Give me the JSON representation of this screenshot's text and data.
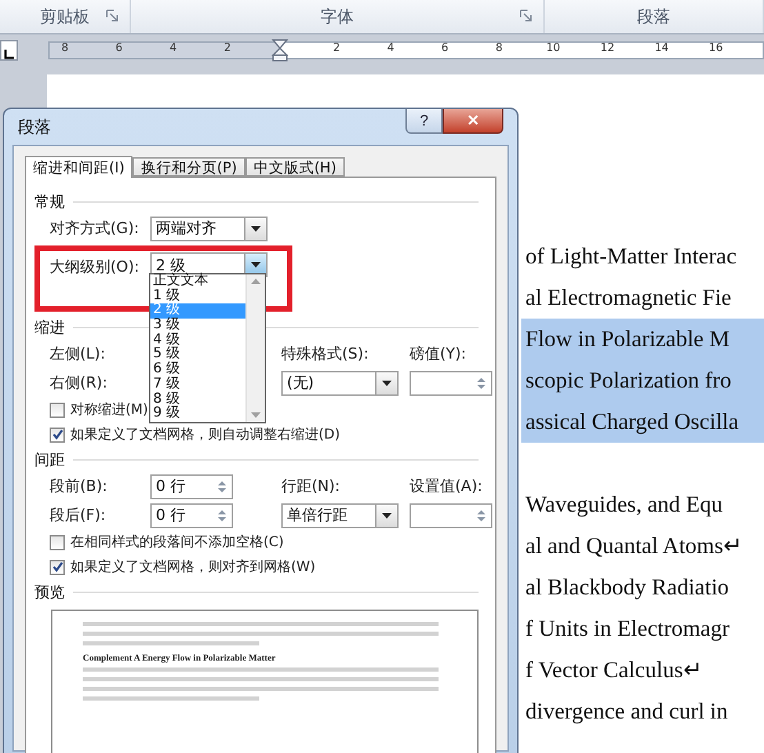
{
  "ribbon": {
    "groups": [
      {
        "label": "剪贴板",
        "launcher": true
      },
      {
        "label": "字体",
        "launcher": true
      },
      {
        "label": "段落",
        "launcher": false
      }
    ]
  },
  "ruler": {
    "left_numbers": [
      "8",
      "6",
      "4",
      "2"
    ],
    "right_numbers": [
      "2",
      "4",
      "6",
      "8",
      "10",
      "12",
      "14",
      "16"
    ]
  },
  "document": {
    "lines": [
      {
        "kind": "text",
        "text": "of Light-Matter Interac",
        "highlighted": false
      },
      {
        "kind": "text",
        "text": "al Electromagnetic Fie",
        "highlighted": false
      },
      {
        "kind": "text",
        "text": "Flow in Polarizable M",
        "highlighted": true
      },
      {
        "kind": "text",
        "text": "scopic Polarization fro",
        "highlighted": true
      },
      {
        "kind": "text",
        "text": "assical Charged Oscilla",
        "highlighted": true
      },
      {
        "kind": "blank"
      },
      {
        "kind": "text",
        "text": "Waveguides, and Equ",
        "highlighted": false
      },
      {
        "kind": "text",
        "text": "al and Quantal Atoms↵",
        "highlighted": false
      },
      {
        "kind": "text",
        "text": "al Blackbody Radiatio",
        "highlighted": false
      },
      {
        "kind": "text",
        "text": "f Units in Electromagr",
        "highlighted": false
      },
      {
        "kind": "text",
        "text": "f Vector Calculus↵",
        "highlighted": false
      },
      {
        "kind": "text",
        "text": "divergence and curl in",
        "highlighted": false
      }
    ]
  },
  "dialog": {
    "title": "段落",
    "help": "?",
    "close": "✕",
    "tabs": [
      {
        "label": "缩进和间距(I)",
        "selected": true
      },
      {
        "label": "换行和分页(P)",
        "selected": false
      },
      {
        "label": "中文版式(H)",
        "selected": false
      }
    ],
    "general": {
      "heading": "常规",
      "alignment": {
        "label": "对齐方式(G):",
        "value": "两端对齐"
      },
      "outline_level": {
        "label": "大纲级别(O):",
        "value": "2 级",
        "expanded": true,
        "options": [
          {
            "label": "正文文本",
            "selected": false
          },
          {
            "label": "1 级",
            "selected": false
          },
          {
            "label": "2 级",
            "selected": true
          },
          {
            "label": "3 级",
            "selected": false
          },
          {
            "label": "4 级",
            "selected": false
          },
          {
            "label": "5 级",
            "selected": false
          },
          {
            "label": "6 级",
            "selected": false
          },
          {
            "label": "7 级",
            "selected": false
          },
          {
            "label": "8 级",
            "selected": false
          },
          {
            "label": "9 级",
            "selected": false
          }
        ]
      }
    },
    "indent": {
      "heading": "缩进",
      "left_label": "左侧(L):",
      "right_label": "右侧(R):",
      "special": {
        "label": "特殊格式(S):",
        "value": "(无)"
      },
      "by": {
        "label": "磅值(Y):"
      },
      "checkboxes": [
        {
          "label": "对称缩进(M)",
          "checked": false
        },
        {
          "label": "如果定义了文档网格，则自动调整右缩进(D)",
          "checked": true
        }
      ]
    },
    "spacing": {
      "heading": "间距",
      "before": {
        "label": "段前(B):",
        "value": "0 行"
      },
      "after": {
        "label": "段后(F):",
        "value": "0 行"
      },
      "line": {
        "label": "行距(N):",
        "value": "单倍行距"
      },
      "at": {
        "label": "设置值(A):"
      },
      "checkboxes": [
        {
          "label": "在相同样式的段落间不添加空格(C)",
          "checked": false
        },
        {
          "label": "如果定义了文档网格，则对齐到网格(W)",
          "checked": true
        }
      ]
    },
    "preview": {
      "heading": "预览",
      "sample": "Complement A Energy Flow in Polarizable Matter"
    }
  },
  "callout_frame": true
}
